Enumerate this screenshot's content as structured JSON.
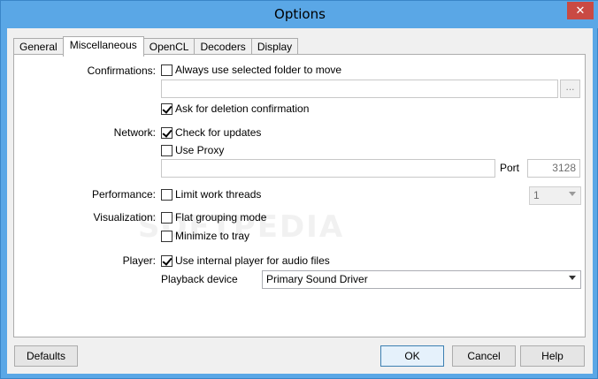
{
  "window": {
    "title": "Options",
    "close_symbol": "✕"
  },
  "tabs": [
    {
      "label": "General",
      "active": false
    },
    {
      "label": "Miscellaneous",
      "active": true
    },
    {
      "label": "OpenCL",
      "active": false
    },
    {
      "label": "Decoders",
      "active": false
    },
    {
      "label": "Display",
      "active": false
    }
  ],
  "confirmations": {
    "label": "Confirmations:",
    "always_folder": {
      "label": "Always use selected folder to move",
      "checked": false
    },
    "folder_path": {
      "value": ""
    },
    "browse_label": "...",
    "ask_deletion": {
      "label": "Ask for deletion confirmation",
      "checked": true
    }
  },
  "network": {
    "label": "Network:",
    "check_updates": {
      "label": "Check for updates",
      "checked": true
    },
    "use_proxy": {
      "label": "Use Proxy",
      "checked": false
    },
    "proxy_address": {
      "value": ""
    },
    "port_label": "Port",
    "port_value": "3128"
  },
  "performance": {
    "label": "Performance:",
    "limit_threads": {
      "label": "Limit work threads",
      "checked": false
    },
    "threads_value": "1"
  },
  "visualization": {
    "label": "Visualization:",
    "flat_grouping": {
      "label": "Flat grouping mode",
      "checked": false
    },
    "minimize_tray": {
      "label": "Minimize to tray",
      "checked": false
    }
  },
  "player": {
    "label": "Player:",
    "internal_player": {
      "label": "Use internal player for audio files",
      "checked": true
    },
    "playback_label": "Playback device",
    "playback_value": "Primary Sound Driver"
  },
  "watermark": "SOFTPEDIA",
  "footer": {
    "defaults": "Defaults",
    "ok": "OK",
    "cancel": "Cancel",
    "help": "Help"
  }
}
